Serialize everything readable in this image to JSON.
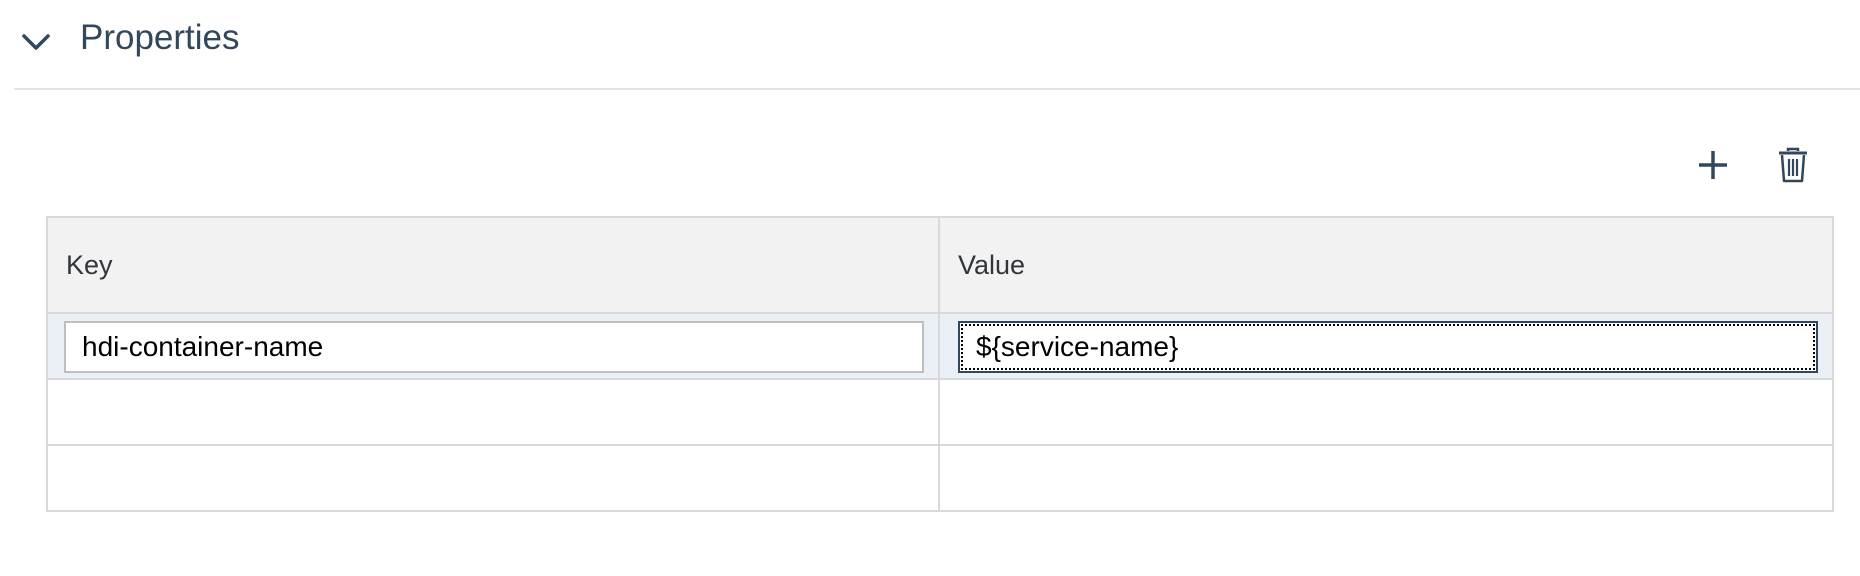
{
  "section": {
    "title": "Properties",
    "expanded": true
  },
  "toolbar": {
    "add_icon": "plus-icon",
    "delete_icon": "trash-icon"
  },
  "table": {
    "columns": [
      "Key",
      "Value"
    ],
    "rows": [
      {
        "key": "hdi-container-name",
        "value": "${service-name}"
      },
      {
        "key": "",
        "value": ""
      },
      {
        "key": "",
        "value": ""
      }
    ]
  },
  "colors": {
    "title": "#32475c",
    "header_bg": "#f2f2f2",
    "selected_row_bg": "#eaf0f6",
    "border": "#d9d9d9"
  }
}
